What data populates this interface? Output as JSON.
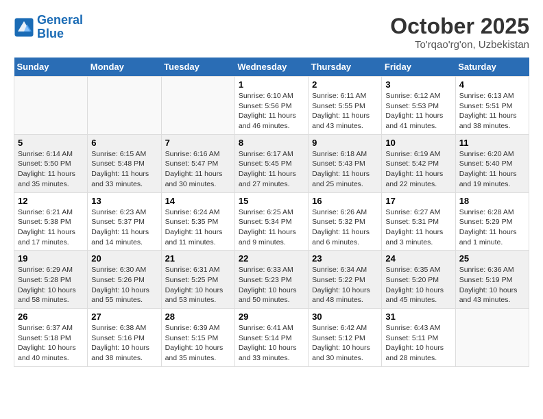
{
  "header": {
    "logo_line1": "General",
    "logo_line2": "Blue",
    "month": "October 2025",
    "location": "To'rqao'rg'on, Uzbekistan"
  },
  "weekdays": [
    "Sunday",
    "Monday",
    "Tuesday",
    "Wednesday",
    "Thursday",
    "Friday",
    "Saturday"
  ],
  "weeks": [
    [
      {
        "day": "",
        "info": ""
      },
      {
        "day": "",
        "info": ""
      },
      {
        "day": "",
        "info": ""
      },
      {
        "day": "1",
        "info": "Sunrise: 6:10 AM\nSunset: 5:56 PM\nDaylight: 11 hours and 46 minutes."
      },
      {
        "day": "2",
        "info": "Sunrise: 6:11 AM\nSunset: 5:55 PM\nDaylight: 11 hours and 43 minutes."
      },
      {
        "day": "3",
        "info": "Sunrise: 6:12 AM\nSunset: 5:53 PM\nDaylight: 11 hours and 41 minutes."
      },
      {
        "day": "4",
        "info": "Sunrise: 6:13 AM\nSunset: 5:51 PM\nDaylight: 11 hours and 38 minutes."
      }
    ],
    [
      {
        "day": "5",
        "info": "Sunrise: 6:14 AM\nSunset: 5:50 PM\nDaylight: 11 hours and 35 minutes."
      },
      {
        "day": "6",
        "info": "Sunrise: 6:15 AM\nSunset: 5:48 PM\nDaylight: 11 hours and 33 minutes."
      },
      {
        "day": "7",
        "info": "Sunrise: 6:16 AM\nSunset: 5:47 PM\nDaylight: 11 hours and 30 minutes."
      },
      {
        "day": "8",
        "info": "Sunrise: 6:17 AM\nSunset: 5:45 PM\nDaylight: 11 hours and 27 minutes."
      },
      {
        "day": "9",
        "info": "Sunrise: 6:18 AM\nSunset: 5:43 PM\nDaylight: 11 hours and 25 minutes."
      },
      {
        "day": "10",
        "info": "Sunrise: 6:19 AM\nSunset: 5:42 PM\nDaylight: 11 hours and 22 minutes."
      },
      {
        "day": "11",
        "info": "Sunrise: 6:20 AM\nSunset: 5:40 PM\nDaylight: 11 hours and 19 minutes."
      }
    ],
    [
      {
        "day": "12",
        "info": "Sunrise: 6:21 AM\nSunset: 5:38 PM\nDaylight: 11 hours and 17 minutes."
      },
      {
        "day": "13",
        "info": "Sunrise: 6:23 AM\nSunset: 5:37 PM\nDaylight: 11 hours and 14 minutes."
      },
      {
        "day": "14",
        "info": "Sunrise: 6:24 AM\nSunset: 5:35 PM\nDaylight: 11 hours and 11 minutes."
      },
      {
        "day": "15",
        "info": "Sunrise: 6:25 AM\nSunset: 5:34 PM\nDaylight: 11 hours and 9 minutes."
      },
      {
        "day": "16",
        "info": "Sunrise: 6:26 AM\nSunset: 5:32 PM\nDaylight: 11 hours and 6 minutes."
      },
      {
        "day": "17",
        "info": "Sunrise: 6:27 AM\nSunset: 5:31 PM\nDaylight: 11 hours and 3 minutes."
      },
      {
        "day": "18",
        "info": "Sunrise: 6:28 AM\nSunset: 5:29 PM\nDaylight: 11 hours and 1 minute."
      }
    ],
    [
      {
        "day": "19",
        "info": "Sunrise: 6:29 AM\nSunset: 5:28 PM\nDaylight: 10 hours and 58 minutes."
      },
      {
        "day": "20",
        "info": "Sunrise: 6:30 AM\nSunset: 5:26 PM\nDaylight: 10 hours and 55 minutes."
      },
      {
        "day": "21",
        "info": "Sunrise: 6:31 AM\nSunset: 5:25 PM\nDaylight: 10 hours and 53 minutes."
      },
      {
        "day": "22",
        "info": "Sunrise: 6:33 AM\nSunset: 5:23 PM\nDaylight: 10 hours and 50 minutes."
      },
      {
        "day": "23",
        "info": "Sunrise: 6:34 AM\nSunset: 5:22 PM\nDaylight: 10 hours and 48 minutes."
      },
      {
        "day": "24",
        "info": "Sunrise: 6:35 AM\nSunset: 5:20 PM\nDaylight: 10 hours and 45 minutes."
      },
      {
        "day": "25",
        "info": "Sunrise: 6:36 AM\nSunset: 5:19 PM\nDaylight: 10 hours and 43 minutes."
      }
    ],
    [
      {
        "day": "26",
        "info": "Sunrise: 6:37 AM\nSunset: 5:18 PM\nDaylight: 10 hours and 40 minutes."
      },
      {
        "day": "27",
        "info": "Sunrise: 6:38 AM\nSunset: 5:16 PM\nDaylight: 10 hours and 38 minutes."
      },
      {
        "day": "28",
        "info": "Sunrise: 6:39 AM\nSunset: 5:15 PM\nDaylight: 10 hours and 35 minutes."
      },
      {
        "day": "29",
        "info": "Sunrise: 6:41 AM\nSunset: 5:14 PM\nDaylight: 10 hours and 33 minutes."
      },
      {
        "day": "30",
        "info": "Sunrise: 6:42 AM\nSunset: 5:12 PM\nDaylight: 10 hours and 30 minutes."
      },
      {
        "day": "31",
        "info": "Sunrise: 6:43 AM\nSunset: 5:11 PM\nDaylight: 10 hours and 28 minutes."
      },
      {
        "day": "",
        "info": ""
      }
    ]
  ]
}
